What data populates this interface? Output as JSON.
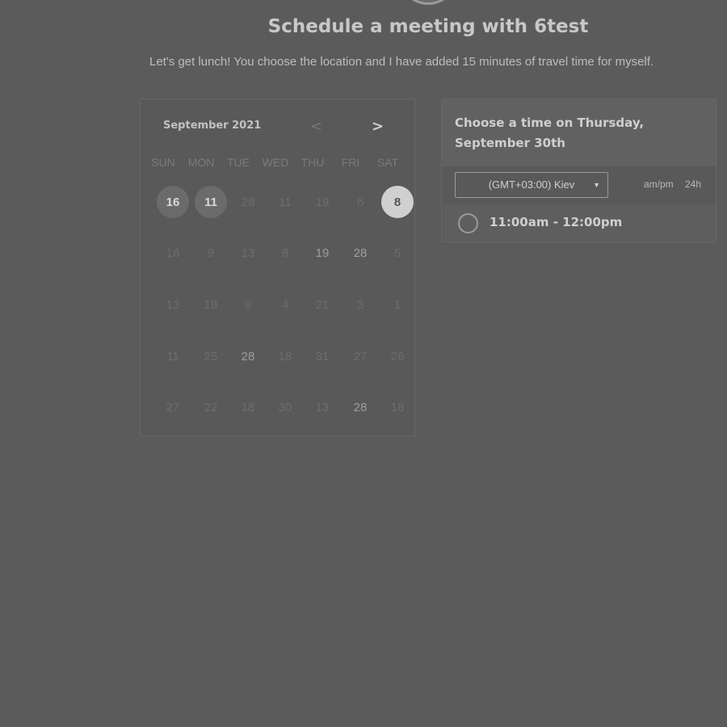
{
  "header": {
    "title": "Schedule a meeting with 6test",
    "subtitle": "Let's get lunch! You choose the location and I have added 15 minutes of travel time for myself."
  },
  "calendar": {
    "month": "September 2021",
    "prev": "<",
    "next": ">",
    "weekdays": [
      "SUN",
      "MON",
      "TUE",
      "WED",
      "THU",
      "FRI",
      "SAT"
    ],
    "weeks": [
      [
        {
          "d": "16",
          "s": "avail"
        },
        {
          "d": "11",
          "s": "avail"
        },
        {
          "d": "28",
          "s": ""
        },
        {
          "d": "11",
          "s": ""
        },
        {
          "d": "19",
          "s": ""
        },
        {
          "d": "6",
          "s": ""
        },
        {
          "d": "8",
          "s": "sel"
        }
      ],
      [
        {
          "d": "16",
          "s": ""
        },
        {
          "d": "9",
          "s": ""
        },
        {
          "d": "13",
          "s": ""
        },
        {
          "d": "8",
          "s": ""
        },
        {
          "d": "19",
          "s": "light"
        },
        {
          "d": "28",
          "s": "light"
        },
        {
          "d": "5",
          "s": ""
        }
      ],
      [
        {
          "d": "13",
          "s": ""
        },
        {
          "d": "18",
          "s": ""
        },
        {
          "d": "9",
          "s": ""
        },
        {
          "d": "4",
          "s": ""
        },
        {
          "d": "21",
          "s": ""
        },
        {
          "d": "3",
          "s": ""
        },
        {
          "d": "1",
          "s": ""
        }
      ],
      [
        {
          "d": "11",
          "s": ""
        },
        {
          "d": "25",
          "s": ""
        },
        {
          "d": "28",
          "s": "light"
        },
        {
          "d": "18",
          "s": ""
        },
        {
          "d": "31",
          "s": ""
        },
        {
          "d": "27",
          "s": ""
        },
        {
          "d": "26",
          "s": ""
        }
      ],
      [
        {
          "d": "27",
          "s": ""
        },
        {
          "d": "22",
          "s": ""
        },
        {
          "d": "18",
          "s": ""
        },
        {
          "d": "30",
          "s": ""
        },
        {
          "d": "13",
          "s": ""
        },
        {
          "d": "28",
          "s": "light"
        },
        {
          "d": "18",
          "s": ""
        }
      ]
    ]
  },
  "timepanel": {
    "heading_line1": "Choose a time on Thursday,",
    "heading_line2": "September 30th",
    "timezone": "(GMT+03:00) Kiev",
    "format_ampm": "am/pm",
    "format_24h": "24h",
    "slots": [
      "11:00am - 12:00pm"
    ]
  },
  "colors": {
    "background": "#5b5b5b",
    "selected_day": "#d0d0d0"
  }
}
